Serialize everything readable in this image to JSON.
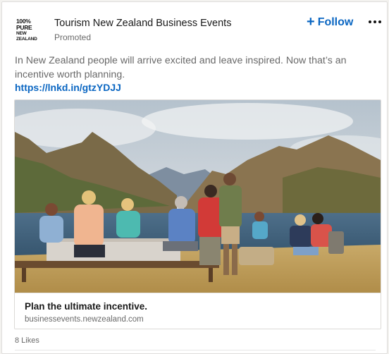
{
  "post": {
    "company_name": "Tourism New Zealand Business Events",
    "sponsored_label": "Promoted",
    "logo": {
      "line1": "100% PURE",
      "line2": "NEW ZEALAND"
    },
    "follow_label": "Follow",
    "body_text": "In New Zealand people will arrive excited and leave inspired. Now that’s an incentive worth planning.",
    "link_text": "https://lnkd.in/gtzYDJJ",
    "preview": {
      "headline": "Plan the ultimate incentive.",
      "domain": "businessevents.newzealand.com"
    },
    "likes_text": "8 Likes"
  },
  "colors": {
    "accent": "#0a66c2",
    "page_bg": "#f3f2ef",
    "card_bg": "#ffffff"
  },
  "icons": {
    "follow": "plus-icon",
    "more": "more-horizontal-icon"
  }
}
